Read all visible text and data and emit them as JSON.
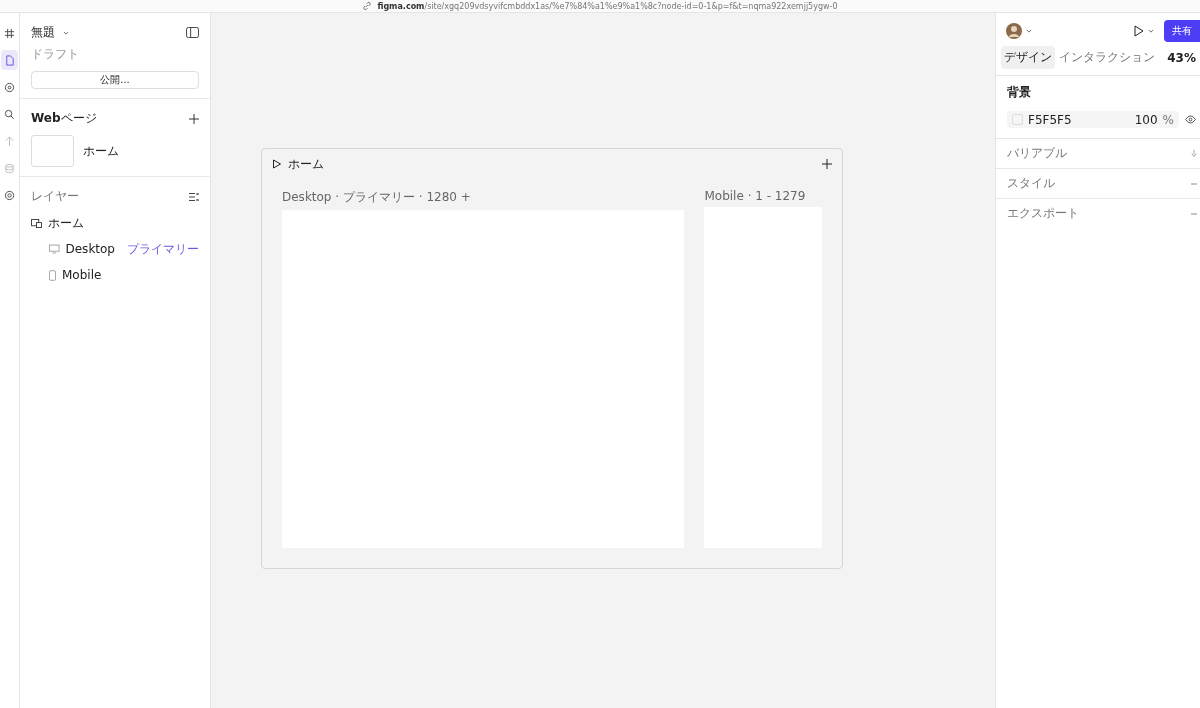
{
  "browser": {
    "url_domain": "figma.com",
    "url_path": "/site/xgq209vdsyvifcmbddx1as/%e7%84%a1%e9%a1%8c?node-id=0-1&p=f&t=nqma922xemjj5ygw-0"
  },
  "rail": [
    {
      "kind": "grid",
      "selected": false
    },
    {
      "kind": "page",
      "selected": true
    },
    {
      "kind": "target",
      "selected": false
    },
    {
      "kind": "search",
      "selected": false
    },
    {
      "kind": "share",
      "selected": false
    },
    {
      "kind": "db",
      "selected": false
    },
    {
      "kind": "gear",
      "selected": false
    }
  ],
  "file": {
    "title": "無題",
    "subtitle": "ドラフト",
    "publish_button": "公開..."
  },
  "webpages": {
    "title_bold": "Web",
    "title_rest": "ページ",
    "pages": [
      {
        "name": "ホーム"
      }
    ]
  },
  "layers": {
    "title": "レイヤー",
    "items": [
      {
        "name": "ホーム",
        "kind": "page",
        "children": [
          {
            "name": "Desktop",
            "kind": "desktop",
            "tag": "プライマリー"
          },
          {
            "name": "Mobile",
            "kind": "mobile"
          }
        ]
      }
    ]
  },
  "canvas": {
    "page_title": "ホーム",
    "frames": [
      {
        "label": "Desktop · プライマリー · 1280 +",
        "kind": "desktop"
      },
      {
        "label": "Mobile · 1 - 1279",
        "kind": "mobile"
      }
    ]
  },
  "right": {
    "share_button": "共有",
    "tabs": [
      {
        "label": "デザイン",
        "selected": true
      },
      {
        "label": "インタラクション",
        "selected": false
      }
    ],
    "zoom": "43%",
    "background": {
      "title": "背景",
      "hex": "F5F5F5",
      "opacity": "100",
      "unit": "%"
    },
    "sections": [
      {
        "label": "バリアブル",
        "kind": "link"
      },
      {
        "label": "スタイル",
        "kind": "minus"
      },
      {
        "label": "エクスポート",
        "kind": "minus"
      }
    ]
  }
}
